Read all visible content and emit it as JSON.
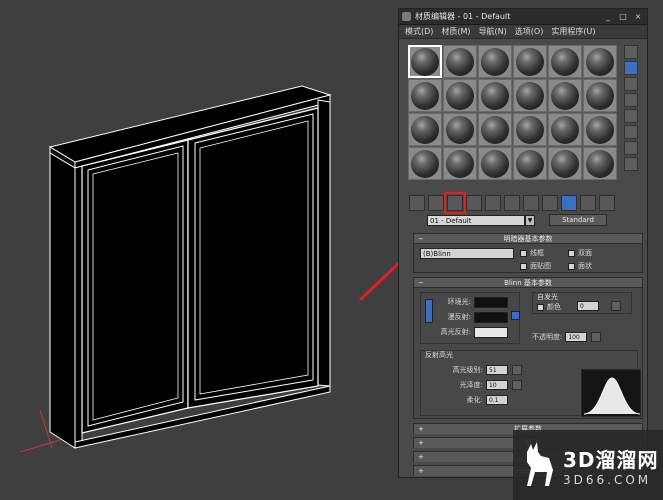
{
  "editor": {
    "title": "材质编辑器 - 01 - Default",
    "menu": [
      "模式(D)",
      "材质(M)",
      "导航(N)",
      "选项(O)",
      "实用程序(U)"
    ],
    "win_buttons": [
      "_",
      "□",
      "×"
    ],
    "material_name": "01 - Default",
    "material_type": "Standard",
    "shader_header": "明暗器基本参数",
    "shader_value": "(B)Blinn",
    "shader_checks": [
      "线框",
      "双面",
      "面贴图",
      "面状"
    ],
    "blinn_header": "Blinn 基本参数",
    "self_illum_label": "自发光",
    "color_label": "颜色",
    "color_value": "0",
    "ambient_label": "环境光:",
    "diffuse_label": "漫反射:",
    "specular_label": "高光反射:",
    "opacity_label": "不透明度:",
    "opacity_value": "100",
    "spec_hl_label": "反射高光",
    "spec_level_label": "高光级别:",
    "spec_level_value": "51",
    "gloss_label": "光泽度:",
    "gloss_value": "10",
    "soften_label": "柔化:",
    "soften_value": "0.1",
    "ext_header": "扩展参数",
    "supersample_header": "超",
    "mental_header": "menta"
  },
  "watermark": {
    "main": "3D溜溜网",
    "sub": "3D66.COM"
  },
  "colors": {
    "highlight_red": "#e41e1e",
    "accent_blue": "#3b6fc2"
  },
  "icons": {
    "highlighted_tool": "put-material-to-scene-icon"
  }
}
